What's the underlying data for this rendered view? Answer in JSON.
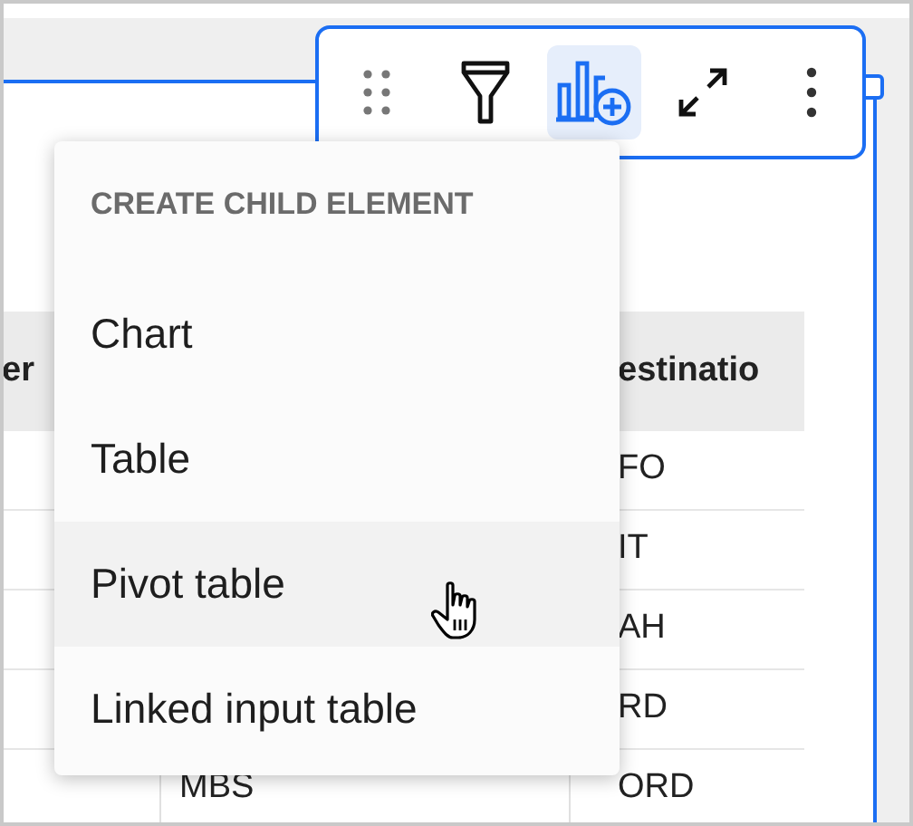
{
  "toolbar": {
    "buttons": [
      {
        "kind": "drag",
        "selected": false
      },
      {
        "kind": "filter",
        "selected": false
      },
      {
        "kind": "add_child",
        "selected": true
      },
      {
        "kind": "expand",
        "selected": false
      },
      {
        "kind": "more",
        "selected": false
      }
    ]
  },
  "table": {
    "header": {
      "column_1": "er",
      "column_3": "estinatio"
    },
    "rows": [
      {
        "column_3": "FO"
      },
      {
        "column_3": "IT"
      },
      {
        "column_3": "AH"
      },
      {
        "column_3": "RD"
      },
      {
        "column_2": "MBS",
        "column_3": "ORD"
      }
    ]
  },
  "menu": {
    "heading": "CREATE CHILD ELEMENT",
    "items": [
      {
        "label": "Chart",
        "highlighted": false
      },
      {
        "label": "Table",
        "highlighted": false
      },
      {
        "label": "Pivot table",
        "highlighted": true
      },
      {
        "label": "Linked input table",
        "highlighted": false
      }
    ]
  }
}
